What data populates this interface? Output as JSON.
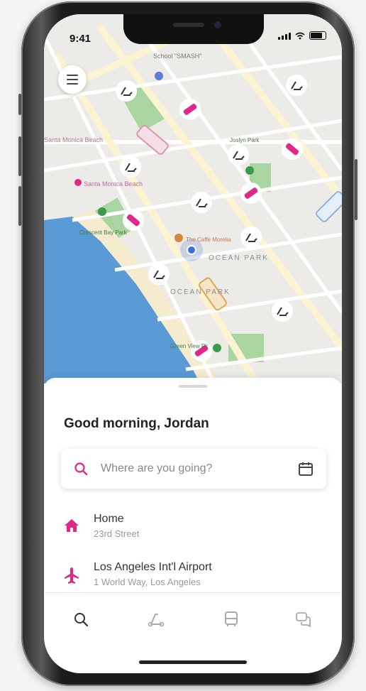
{
  "status": {
    "time": "9:41"
  },
  "map": {
    "labels": [
      {
        "text": "School \"SMASH\"",
        "color": "#777777"
      },
      {
        "text": "Santa Monica Beach",
        "color": "#ad7a8f"
      },
      {
        "text": "Santa Monica Beach",
        "color": "#c06e9e"
      },
      {
        "text": "Crescent Bay Park",
        "color": "#4a7a4a"
      },
      {
        "text": "OCEAN PARK",
        "color": "#8e8e8e"
      },
      {
        "text": "OCEAN PARK",
        "color": "#8e8e8e"
      },
      {
        "text": "Green View Pk",
        "color": "#4a7a4a"
      },
      {
        "text": "Joslyn Park",
        "color": "#4a7a4a"
      },
      {
        "text": "The Caffe Morelia",
        "color": "#c07a4a"
      }
    ]
  },
  "sheet": {
    "greeting": "Good morning, Jordan",
    "search": {
      "placeholder": "Where are you going?",
      "icon": "search-icon",
      "calendar_icon": "calendar-icon"
    },
    "places": [
      {
        "name": "Home",
        "subtitle": "23rd Street",
        "icon": "home-icon"
      },
      {
        "name": "Los Angeles Int'l Airport",
        "subtitle": "1 World Way, Los Angeles",
        "icon": "airplane-icon"
      }
    ]
  },
  "tabs": [
    {
      "icon": "search-icon",
      "active": true
    },
    {
      "icon": "scooter-icon",
      "active": false
    },
    {
      "icon": "bus-icon",
      "active": false
    },
    {
      "icon": "chat-icon",
      "active": false
    }
  ],
  "colors": {
    "accent": "#e0288a",
    "water": "#5b9bd5",
    "park": "#a9d6a0",
    "road": "#fbf3d2"
  }
}
